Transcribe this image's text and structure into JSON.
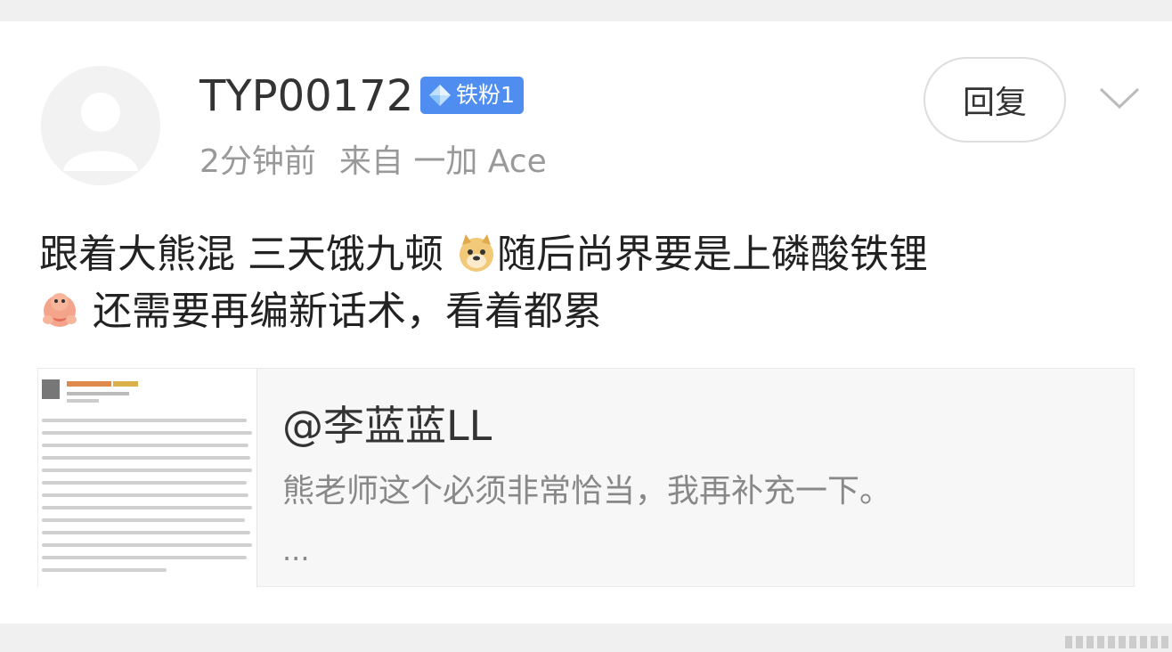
{
  "post": {
    "username": "TYP00172",
    "badge_label": "铁粉1",
    "time": "2分钟前",
    "source": "来自 一加 Ace",
    "reply_label": "回复",
    "content_line1_a": "跟着大熊混 三天饿九顿 ",
    "content_line1_b": "随后尚界要是上磷酸铁锂",
    "content_line2": " 还需要再编新话术，看着都累",
    "emojis": [
      "doge-emoji",
      "heart-hands-emoji"
    ]
  },
  "quote": {
    "author": "@李蓝蓝LL",
    "text": "熊老师这个必须非常恰当，我再补充一下。",
    "ellipsis": "..."
  },
  "colors": {
    "badge": "#4f8ef0",
    "background": "#f0f0f0",
    "card": "#ffffff"
  }
}
